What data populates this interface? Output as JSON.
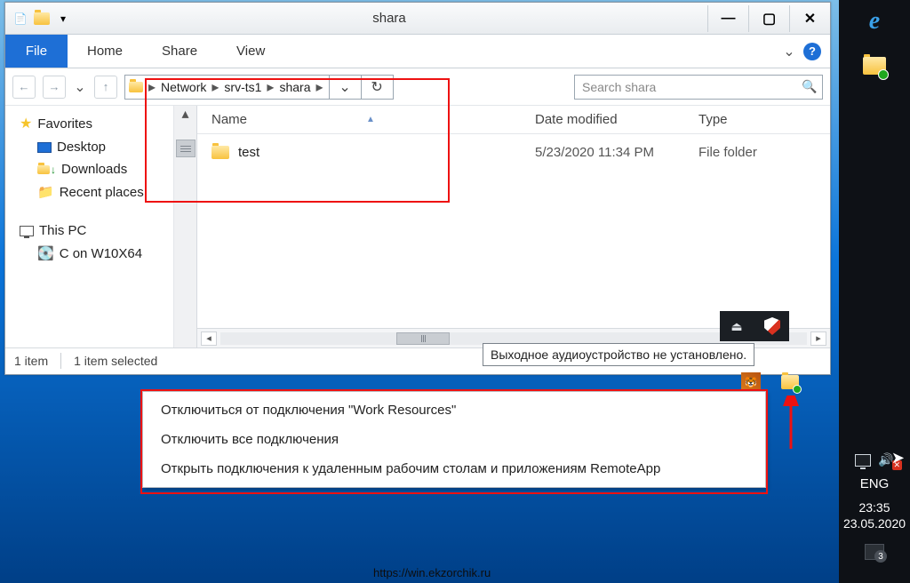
{
  "window": {
    "title": "shara"
  },
  "ribbon": {
    "file": "File",
    "tabs": [
      "Home",
      "Share",
      "View"
    ]
  },
  "nav": {
    "crumbs": [
      "Network",
      "srv-ts1",
      "shara"
    ],
    "search_placeholder": "Search shara"
  },
  "sidebar": {
    "favorites_label": "Favorites",
    "items1": [
      "Desktop",
      "Downloads",
      "Recent places"
    ],
    "thispc_label": "This PC",
    "items2": [
      "C on W10X64"
    ]
  },
  "columns": {
    "name": "Name",
    "date": "Date modified",
    "type": "Type"
  },
  "rows": [
    {
      "name": "test",
      "date": "5/23/2020 11:34 PM",
      "type": "File folder"
    }
  ],
  "status": {
    "items": "1 item",
    "selected": "1 item selected"
  },
  "tooltip": "Выходное аудиоустройство не установлено.",
  "ctxmenu": {
    "i1": "Отключиться от подключения \"Work Resources\"",
    "i2": "Отключить все подключения",
    "i3": "Открыть подключения к удаленным рабочим столам и приложениям RemoteApp"
  },
  "tray": {
    "lang": "ENG",
    "time": "23:35",
    "date": "23.05.2020"
  },
  "footer": "https://win.ekzorchik.ru"
}
